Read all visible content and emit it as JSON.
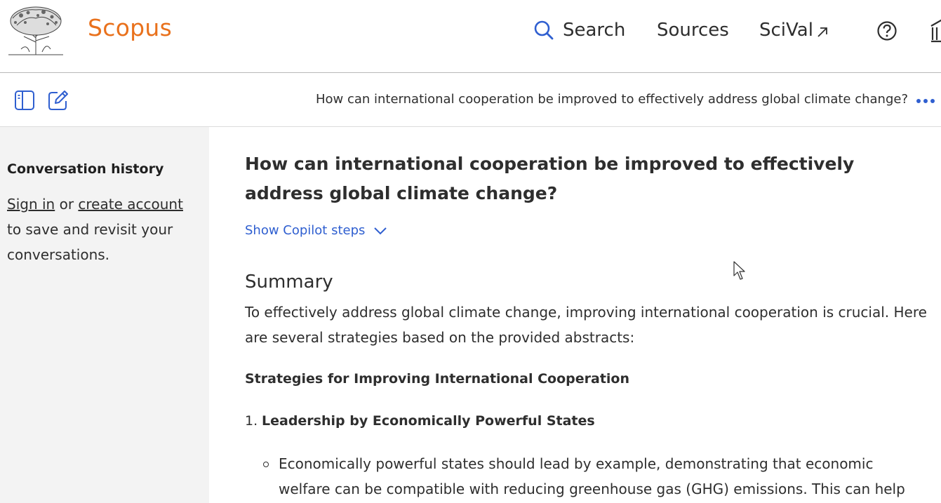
{
  "header": {
    "brand": "Scopus",
    "nav": {
      "search": "Search",
      "sources": "Sources",
      "scival": "SciVal"
    },
    "icons": [
      "elsevier-tree-logo",
      "search-icon",
      "external-arrow-icon",
      "help-circle-icon",
      "institution-icon"
    ]
  },
  "toolbar": {
    "title": "How can international cooperation be improved to effectively address global climate change?",
    "icons": [
      "sidebar-toggle-icon",
      "new-chat-edit-icon",
      "more-dots-icon"
    ]
  },
  "sidebar": {
    "heading": "Conversation history",
    "sign_in": "Sign in",
    "or": " or ",
    "create_account": "create account",
    "rest": " to save and revisit your conversations."
  },
  "main": {
    "question": "How can international cooperation be improved to effectively address global climate change?",
    "copilot_label": "Show Copilot steps",
    "summary_heading": "Summary",
    "summary_text": "To effectively address global climate change, improving international cooperation is crucial. Here are several strategies based on the provided abstracts:",
    "strategies_heading": "Strategies for Improving International Cooperation",
    "item1_number": "1.",
    "item1_title": "Leadership by Economically Powerful States",
    "item1_bullet": "Economically powerful states should lead by example, demonstrating that economic welfare can be compatible with reducing greenhouse gas (GHG) emissions. This can help"
  },
  "colors": {
    "brand": "#e9711c",
    "link_blue": "#2f5fd0",
    "sidebar_bg": "#f3f3f3"
  }
}
